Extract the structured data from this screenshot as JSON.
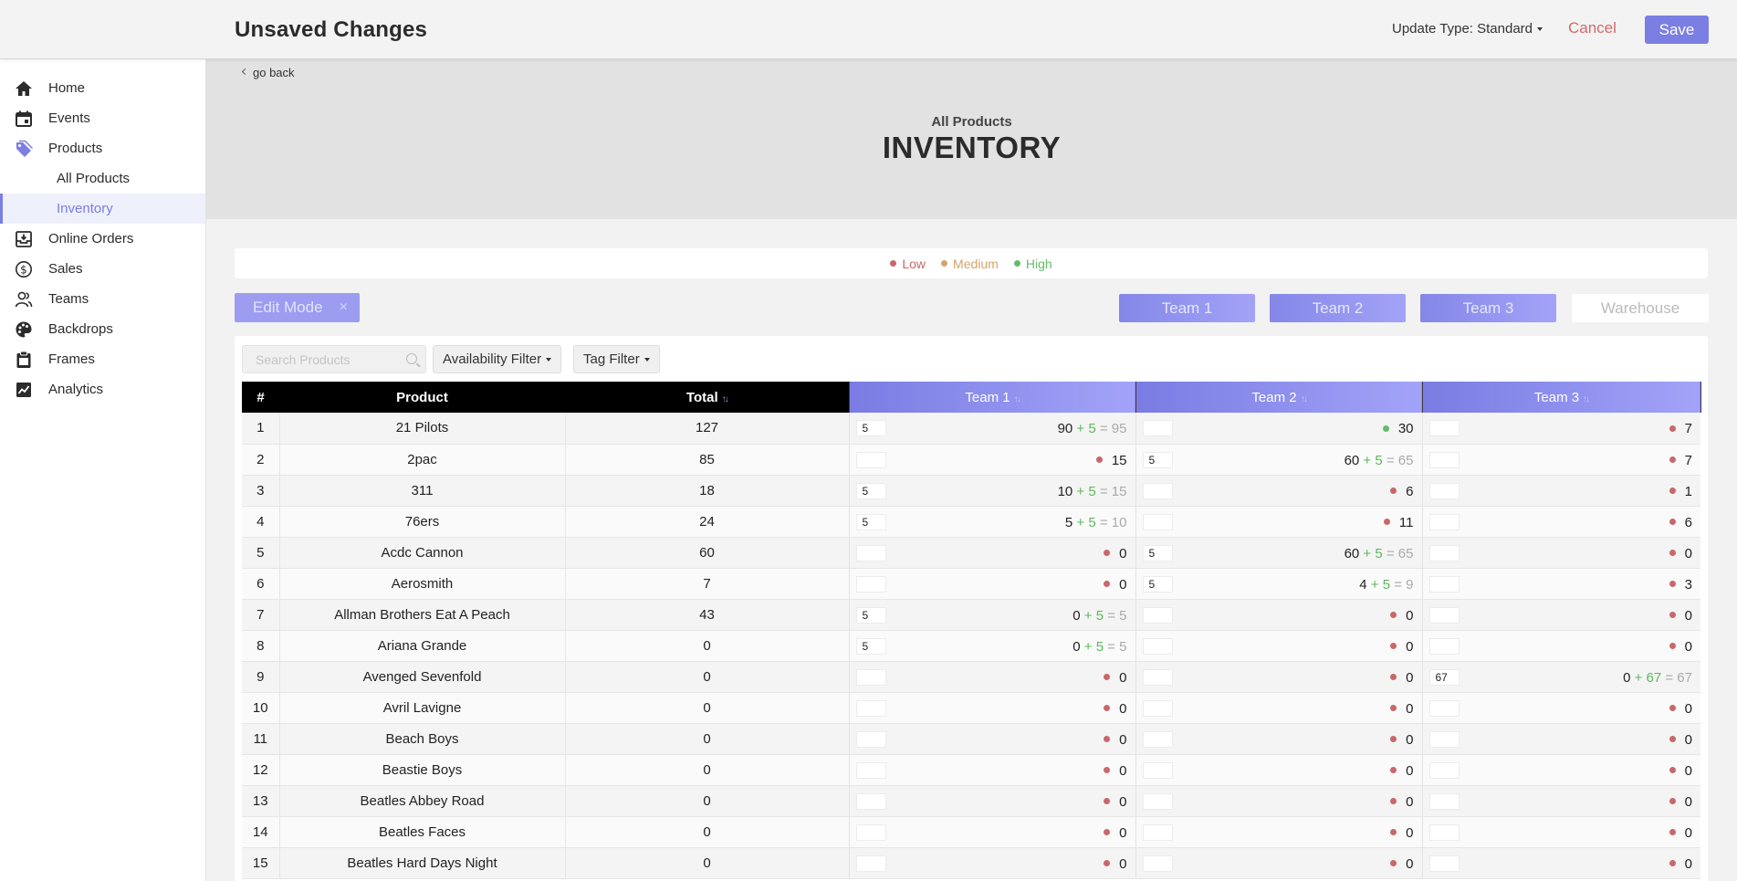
{
  "header": {
    "title": "Unsaved Changes",
    "update_type": "Update Type: Standard",
    "cancel_label": "Cancel",
    "save_label": "Save"
  },
  "sidebar": {
    "items": [
      {
        "label": "Home",
        "icon": "home-icon"
      },
      {
        "label": "Events",
        "icon": "calendar-icon"
      },
      {
        "label": "Products",
        "icon": "tag-icon"
      },
      {
        "label": "All Products",
        "icon": ""
      },
      {
        "label": "Inventory",
        "icon": ""
      },
      {
        "label": "Online Orders",
        "icon": "inbox-download-icon"
      },
      {
        "label": "Sales",
        "icon": "dollar-circle-icon"
      },
      {
        "label": "Teams",
        "icon": "users-icon"
      },
      {
        "label": "Backdrops",
        "icon": "palette-icon"
      },
      {
        "label": "Frames",
        "icon": "clipboard-icon"
      },
      {
        "label": "Analytics",
        "icon": "chart-icon"
      }
    ]
  },
  "page": {
    "go_back": "go back",
    "subtitle": "All Products",
    "title": "INVENTORY"
  },
  "legend": [
    {
      "label": "Low",
      "color": "#c9676a"
    },
    {
      "label": "Medium",
      "color": "#d4a46c"
    },
    {
      "label": "High",
      "color": "#66bb6a"
    }
  ],
  "controls": {
    "edit_mode": "Edit Mode",
    "edit_close": "×",
    "teams": [
      "Team 1",
      "Team 2",
      "Team 3"
    ],
    "warehouse": "Warehouse",
    "search_placeholder": "Search Products",
    "availability_filter": "Availability Filter",
    "tag_filter": "Tag Filter"
  },
  "table": {
    "headers": {
      "num": "#",
      "product": "Product",
      "total": "Total",
      "team1": "Team 1",
      "team2": "Team 2",
      "team3": "Team 3"
    },
    "sort_glyph": "↑↓",
    "rows": [
      {
        "n": "1",
        "product": "21 Pilots",
        "total": "127",
        "cells": [
          {
            "box": "5",
            "base": "90",
            "add": "+ 5",
            "res": "= 95",
            "lvl": ""
          },
          {
            "box": "",
            "base": "30",
            "lvl": "high"
          },
          {
            "box": "",
            "base": "7",
            "lvl": "low"
          }
        ]
      },
      {
        "n": "2",
        "product": "2pac",
        "total": "85",
        "cells": [
          {
            "box": "",
            "base": "15",
            "lvl": "low"
          },
          {
            "box": "5",
            "base": "60",
            "add": "+ 5",
            "res": "= 65",
            "lvl": ""
          },
          {
            "box": "",
            "base": "7",
            "lvl": "low"
          }
        ]
      },
      {
        "n": "3",
        "product": "311",
        "total": "18",
        "cells": [
          {
            "box": "5",
            "base": "10",
            "add": "+ 5",
            "res": "= 15",
            "lvl": ""
          },
          {
            "box": "",
            "base": "6",
            "lvl": "low"
          },
          {
            "box": "",
            "base": "1",
            "lvl": "low"
          }
        ]
      },
      {
        "n": "4",
        "product": "76ers",
        "total": "24",
        "cells": [
          {
            "box": "5",
            "base": "5",
            "add": "+ 5",
            "res": "= 10",
            "lvl": ""
          },
          {
            "box": "",
            "base": "11",
            "lvl": "low"
          },
          {
            "box": "",
            "base": "6",
            "lvl": "low"
          }
        ]
      },
      {
        "n": "5",
        "product": "Acdc Cannon",
        "total": "60",
        "cells": [
          {
            "box": "",
            "base": "0",
            "lvl": "low"
          },
          {
            "box": "5",
            "base": "60",
            "add": "+ 5",
            "res": "= 65",
            "lvl": ""
          },
          {
            "box": "",
            "base": "0",
            "lvl": "low"
          }
        ]
      },
      {
        "n": "6",
        "product": "Aerosmith",
        "total": "7",
        "cells": [
          {
            "box": "",
            "base": "0",
            "lvl": "low"
          },
          {
            "box": "5",
            "base": "4",
            "add": "+ 5",
            "res": "= 9",
            "lvl": ""
          },
          {
            "box": "",
            "base": "3",
            "lvl": "low"
          }
        ]
      },
      {
        "n": "7",
        "product": "Allman Brothers Eat A Peach",
        "total": "43",
        "cells": [
          {
            "box": "5",
            "base": "0",
            "add": "+ 5",
            "res": "= 5",
            "lvl": ""
          },
          {
            "box": "",
            "base": "0",
            "lvl": "low"
          },
          {
            "box": "",
            "base": "0",
            "lvl": "low"
          }
        ]
      },
      {
        "n": "8",
        "product": "Ariana Grande",
        "total": "0",
        "cells": [
          {
            "box": "5",
            "base": "0",
            "add": "+ 5",
            "res": "= 5",
            "lvl": ""
          },
          {
            "box": "",
            "base": "0",
            "lvl": "low"
          },
          {
            "box": "",
            "base": "0",
            "lvl": "low"
          }
        ]
      },
      {
        "n": "9",
        "product": "Avenged Sevenfold",
        "total": "0",
        "cells": [
          {
            "box": "",
            "base": "0",
            "lvl": "low"
          },
          {
            "box": "",
            "base": "0",
            "lvl": "low"
          },
          {
            "box": "67",
            "base": "0",
            "add": "+ 67",
            "res": "= 67",
            "lvl": ""
          }
        ]
      },
      {
        "n": "10",
        "product": "Avril Lavigne",
        "total": "0",
        "cells": [
          {
            "box": "",
            "base": "0",
            "lvl": "low"
          },
          {
            "box": "",
            "base": "0",
            "lvl": "low"
          },
          {
            "box": "",
            "base": "0",
            "lvl": "low"
          }
        ]
      },
      {
        "n": "11",
        "product": "Beach Boys",
        "total": "0",
        "cells": [
          {
            "box": "",
            "base": "0",
            "lvl": "low"
          },
          {
            "box": "",
            "base": "0",
            "lvl": "low"
          },
          {
            "box": "",
            "base": "0",
            "lvl": "low"
          }
        ]
      },
      {
        "n": "12",
        "product": "Beastie Boys",
        "total": "0",
        "cells": [
          {
            "box": "",
            "base": "0",
            "lvl": "low"
          },
          {
            "box": "",
            "base": "0",
            "lvl": "low"
          },
          {
            "box": "",
            "base": "0",
            "lvl": "low"
          }
        ]
      },
      {
        "n": "13",
        "product": "Beatles Abbey Road",
        "total": "0",
        "cells": [
          {
            "box": "",
            "base": "0",
            "lvl": "low"
          },
          {
            "box": "",
            "base": "0",
            "lvl": "low"
          },
          {
            "box": "",
            "base": "0",
            "lvl": "low"
          }
        ]
      },
      {
        "n": "14",
        "product": "Beatles Faces",
        "total": "0",
        "cells": [
          {
            "box": "",
            "base": "0",
            "lvl": "low"
          },
          {
            "box": "",
            "base": "0",
            "lvl": "low"
          },
          {
            "box": "",
            "base": "0",
            "lvl": "low"
          }
        ]
      },
      {
        "n": "15",
        "product": "Beatles Hard Days Night",
        "total": "0",
        "cells": [
          {
            "box": "",
            "base": "0",
            "lvl": "low"
          },
          {
            "box": "",
            "base": "0",
            "lvl": "low"
          },
          {
            "box": "",
            "base": "0",
            "lvl": "low"
          }
        ]
      }
    ]
  },
  "colors": {
    "accent": "#7b7ee2",
    "low": "#c9676a",
    "medium": "#d4a46c",
    "high": "#66bb6a",
    "cancel": "#d26a6a"
  }
}
